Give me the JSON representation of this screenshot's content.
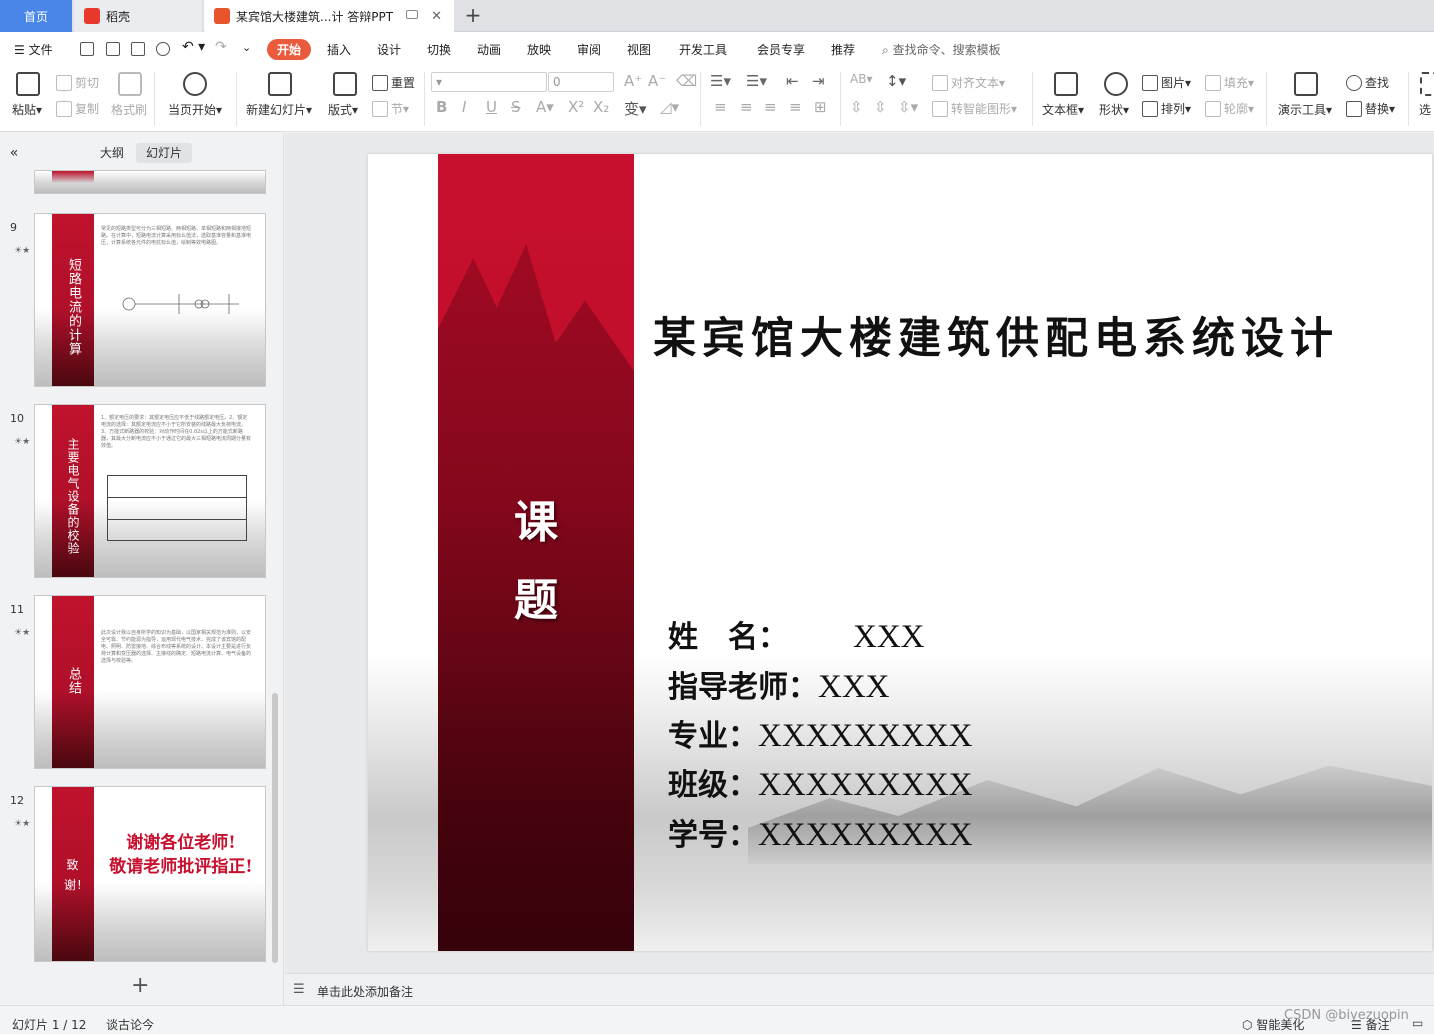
{
  "tabs": {
    "home": "首页",
    "daoke": "稻壳",
    "doc": "某宾馆大楼建筑...计 答辩PPT",
    "new_tab": "+"
  },
  "menu": {
    "file": "文件",
    "items": [
      "开始",
      "插入",
      "设计",
      "切换",
      "动画",
      "放映",
      "审阅",
      "视图",
      "开发工具",
      "会员专享",
      "推荐"
    ],
    "search": "查找命令、搜索模板"
  },
  "ribbon": {
    "paste": "粘贴",
    "cut": "剪切",
    "copy": "复制",
    "format_painter": "格式刷",
    "from_current": "当页开始",
    "new_slide": "新建幻灯片",
    "layout": "版式",
    "reset": "重置",
    "section": "节",
    "font_size": "0",
    "align_text": "对齐文本",
    "smart_art": "转智能图形",
    "text_box": "文本框",
    "shape": "形状",
    "picture": "图片",
    "arrange": "排列",
    "fill": "填充",
    "outline": "轮廓",
    "present_tools": "演示工具",
    "find": "查找",
    "replace": "替换",
    "select": "选"
  },
  "panel": {
    "collapse": "«",
    "tab_outline": "大纲",
    "tab_slides": "幻灯片",
    "add_slide": "+"
  },
  "thumbnails": [
    {
      "num": "9",
      "title": "短路电流的计算",
      "body": "常见的短路类型可分为三相短路、两相短路、单相短路和两相接地短路。在计算中，短路电流计算采用标幺值法，选取基准容量和基准电压，计算系统各元件的电抗标幺值，绘制等效电路图。"
    },
    {
      "num": "10",
      "title": "主要电气设备的校验",
      "body": "1、额定电压的要求：其额定电压应不低于线路额定电压。2、额定电流的选择：其额定电流应不小于它所安装的线路最大负荷电流。3、万能式断路器的校验：对动作时间在0.02s以上的万能式断路器，其最大分断电流应不小于通过它的最大三相短路电流周期分量有效值。"
    },
    {
      "num": "11",
      "title": "总结",
      "body": "此次设计我以自身所学的知识为基础，以国家相关规范为准则，以安全可靠、节约能源为指导，运用现代电气技术，完成了该宾馆的配电、照明、防雷接地、综合布线等系统的设计。本设计主要是进行负荷计算和变压器的选择、主接线的确定、短路电流计算、电气设备的选择与校验等。"
    },
    {
      "num": "12",
      "title": "致谢!",
      "thanks_line1": "谢谢各位老师!",
      "thanks_line2": "敬请老师批评指正!"
    }
  ],
  "slide": {
    "keti_1": "课",
    "keti_2": "题",
    "title": "某宾馆大楼建筑供配电系统设计",
    "rows": [
      {
        "label": "姓　名：",
        "value": "XXX"
      },
      {
        "label": "指导老师：",
        "value": "XXX"
      },
      {
        "label": "专业：",
        "value": "XXXXXXXXX"
      },
      {
        "label": "班级：",
        "value": "XXXXXXXXX"
      },
      {
        "label": "学号：",
        "value": "XXXXXXXXX"
      }
    ]
  },
  "notes": {
    "placeholder": "单击此处添加备注"
  },
  "status": {
    "slide_pos": "幻灯片 1 / 12",
    "theme": "谈古论今",
    "smart_beautify": "智能美化",
    "notes_btn": "备注",
    "watermark": "CSDN @biyezuopin"
  },
  "colors": {
    "accent": "#ea5a3d",
    "home_tab": "#4a86e8",
    "slide_red": "#c8102e"
  }
}
